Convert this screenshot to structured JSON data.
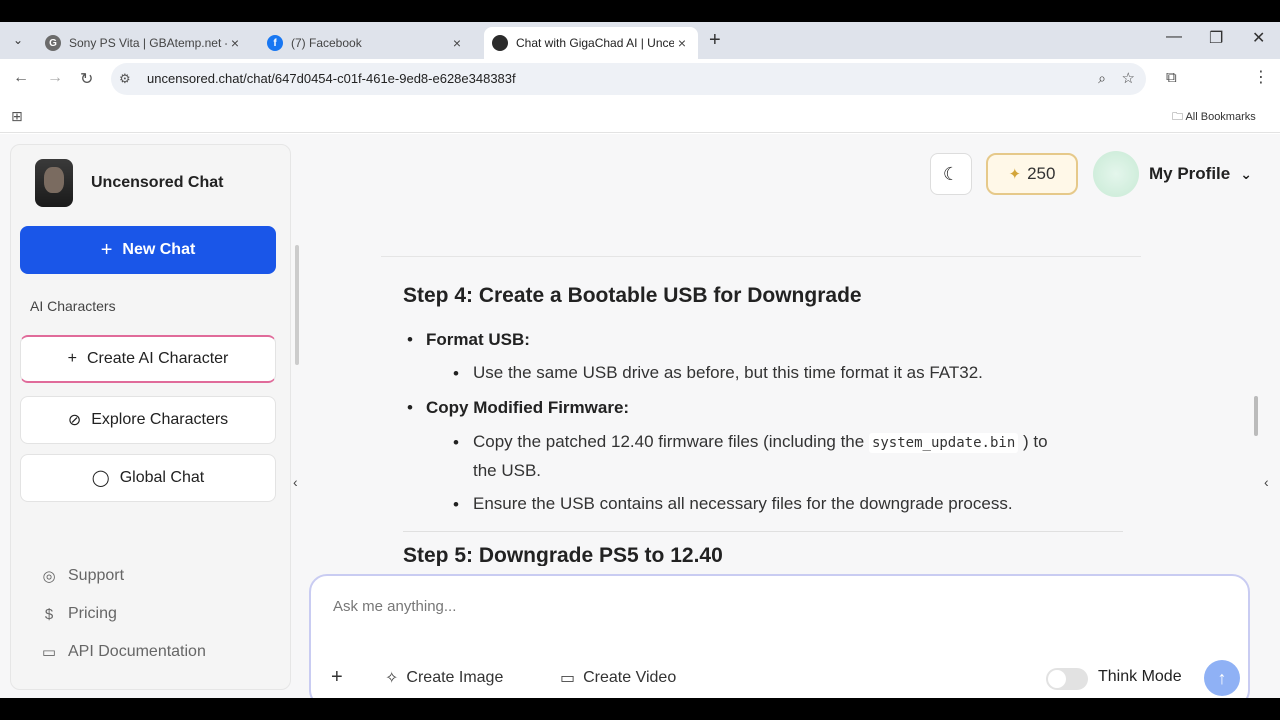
{
  "browser": {
    "tabs": [
      {
        "title": "Sony PS Vita | GBAtemp.net - T",
        "favicon_color": "#6b6b6b",
        "active": false
      },
      {
        "title": "(7) Facebook",
        "favicon_color": "#1877f2",
        "active": false
      },
      {
        "title": "Chat with GigaChad AI | Uncen",
        "favicon_color": "#2b2b2b",
        "active": true
      }
    ],
    "url": "uncensored.chat/chat/647d0454-c01f-461e-9ed8-e628e348383f",
    "bookmarks_label": "All Bookmarks"
  },
  "sidebar": {
    "brand": "Uncensored Chat",
    "new_chat": "New Chat",
    "section_label": "AI Characters",
    "buttons": {
      "create": "Create AI Character",
      "explore": "Explore Characters",
      "global": "Global Chat"
    },
    "footer": {
      "support": "Support",
      "pricing": "Pricing",
      "api": "API Documentation"
    }
  },
  "header": {
    "credits": "250",
    "profile": "My Profile"
  },
  "message": {
    "step4_title": "Step 4: Create a Bootable USB for Downgrade",
    "format_usb": "Format USB:",
    "format_detail": "Use the same USB drive as before, but this time format it as FAT32.",
    "copy_fw": "Copy Modified Firmware:",
    "copy_detail_a": "Copy the patched 12.40 firmware files (including the",
    "copy_detail_code": "system_update.bin",
    "copy_detail_b": ") to",
    "copy_detail_c": "the USB.",
    "ensure_detail": "Ensure the USB contains all necessary files for the downgrade process.",
    "step5_title": "Step 5: Downgrade PS5 to 12.40"
  },
  "composer": {
    "placeholder": "Ask me anything...",
    "create_image": "Create Image",
    "create_video": "Create Video",
    "think_mode": "Think Mode"
  },
  "colors": {
    "primary": "#1a56e8",
    "credits_border": "#e6c98a",
    "send": "#8fb1f5"
  }
}
